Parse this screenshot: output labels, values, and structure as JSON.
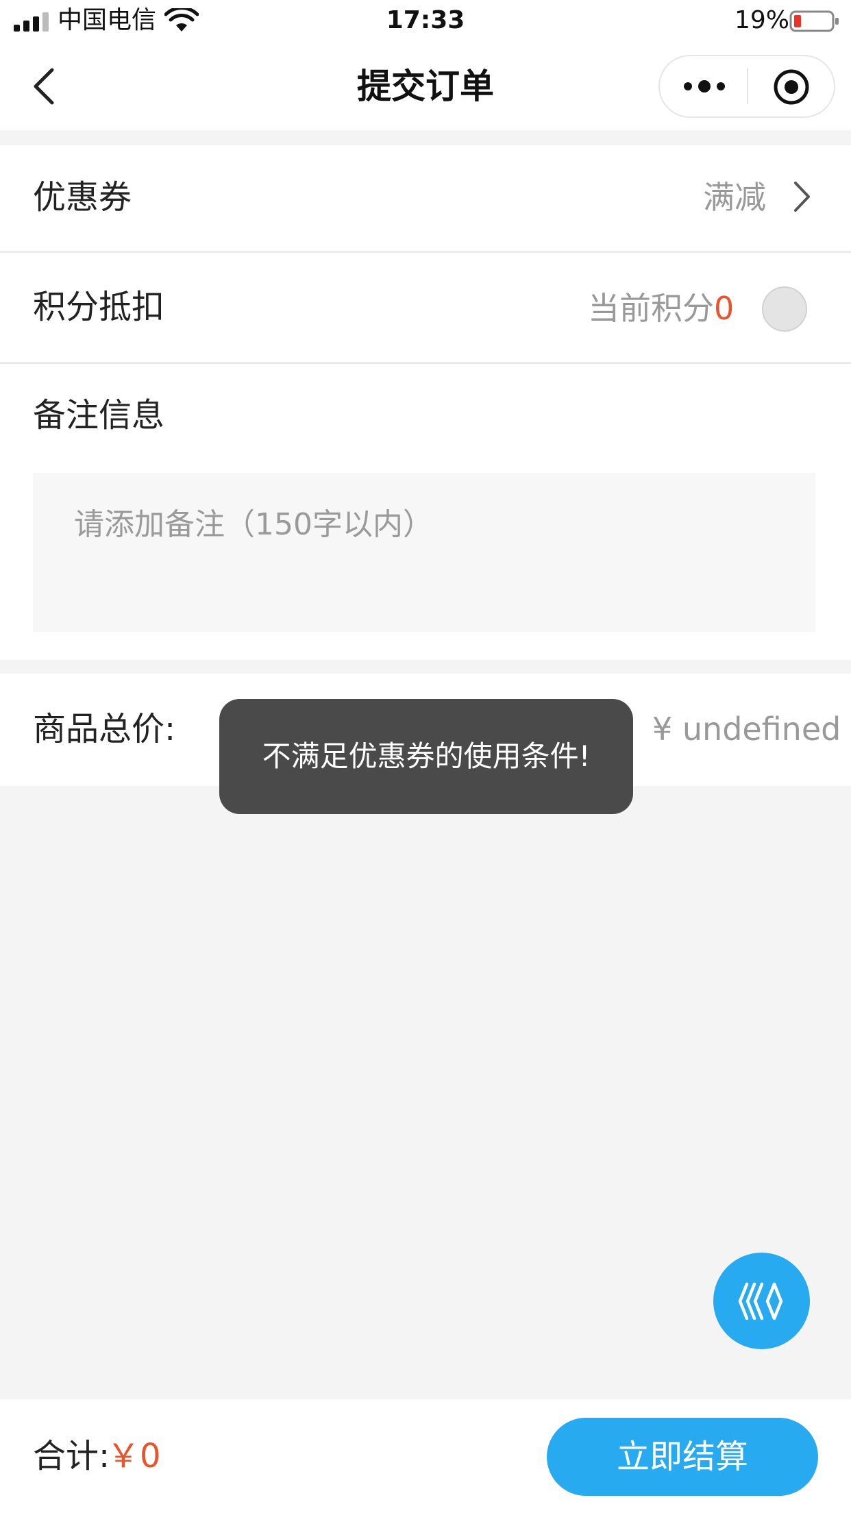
{
  "status_bar": {
    "carrier": "中国电信",
    "time": "17:33",
    "battery_percent": "19%"
  },
  "nav": {
    "title": "提交订单"
  },
  "coupon": {
    "label": "优惠券",
    "value": "满减"
  },
  "points": {
    "label": "积分抵扣",
    "current_label": "当前积分",
    "current_value": "0"
  },
  "remark": {
    "label": "备注信息",
    "placeholder": "请添加备注（150字以内）"
  },
  "goods_total": {
    "label": "商品总价:",
    "value": "¥ undefined"
  },
  "toast": {
    "message": "不满足优惠券的使用条件!"
  },
  "footer": {
    "total_label": "合计:",
    "total_value": "￥0",
    "checkout_label": "立即结算"
  },
  "colors": {
    "accent_blue": "#28aaf0",
    "price_red": "#e8542b",
    "toast_bg": "#4a4a4a",
    "page_bg": "#f4f4f4"
  },
  "icons": {
    "back": "chevron-left-icon",
    "more": "more-dots-icon",
    "close": "target-circle-icon",
    "coupon_arrow": "chevron-right-icon",
    "fab": "brand-logo-icon"
  }
}
